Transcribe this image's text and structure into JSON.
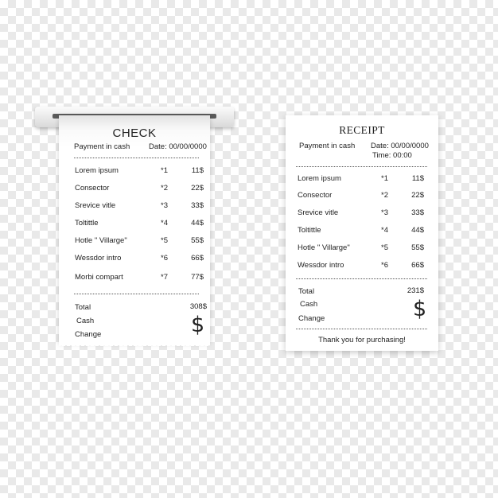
{
  "check": {
    "title": "CHECK",
    "payment": "Payment in cash",
    "date": "Date: 00/00/0000",
    "items": [
      {
        "name": "Lorem ipsum",
        "qty": "*1",
        "price": "11$"
      },
      {
        "name": "Consector",
        "qty": "*2",
        "price": "22$"
      },
      {
        "name": "Srevice vitle",
        "qty": "*3",
        "price": "33$"
      },
      {
        "name": "Toltittle",
        "qty": "*4",
        "price": "44$"
      },
      {
        "name": "Hotle \" Villarge\"",
        "qty": "*5",
        "price": "55$"
      },
      {
        "name": "Wessdor intro",
        "qty": "*6",
        "price": "66$"
      },
      {
        "name": "Morbi compart",
        "qty": "*7",
        "price": "77$"
      }
    ],
    "total_label": "Total",
    "total_value": "308$",
    "cash_label": "Cash",
    "change_label": "Change",
    "currency_symbol": "$"
  },
  "receipt": {
    "title": "RECEIPT",
    "payment": "Payment in cash",
    "date": "Date: 00/00/0000",
    "time": "Time: 00:00",
    "items": [
      {
        "name": "Lorem ipsum",
        "qty": "*1",
        "price": "11$"
      },
      {
        "name": "Consector",
        "qty": "*2",
        "price": "22$"
      },
      {
        "name": "Srevice vitle",
        "qty": "*3",
        "price": "33$"
      },
      {
        "name": "Toltittle",
        "qty": "*4",
        "price": "44$"
      },
      {
        "name": "Hotle \" Villarge\"",
        "qty": "*5",
        "price": "55$"
      },
      {
        "name": "Wessdor intro",
        "qty": "*6",
        "price": "66$"
      }
    ],
    "total_label": "Total",
    "total_value": "231$",
    "cash_label": "Cash",
    "change_label": "Change",
    "currency_symbol": "$",
    "thanks": "Thank you for purchasing!"
  }
}
